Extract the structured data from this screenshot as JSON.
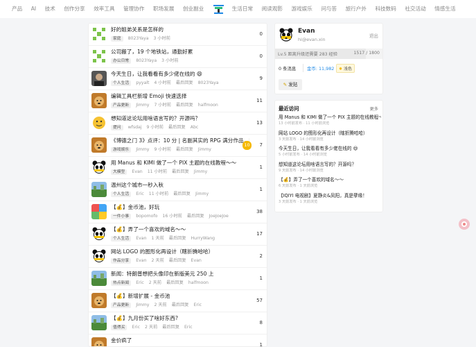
{
  "nav": [
    "产品",
    "AI",
    "技术",
    "创作分享",
    "效率工具",
    "管理协作",
    "职场发展",
    "创业副业",
    "生活日常",
    "阅读观影",
    "游戏娱乐",
    "问与答",
    "旅行户外",
    "科技数码",
    "社交活动",
    "情感生活"
  ],
  "posts": [
    {
      "title": "好的姐弟关系是怎样的",
      "tag": "家庭",
      "author": "8023Yaya",
      "time": "3 小时前",
      "last_label": "",
      "last_user": "",
      "count": "0",
      "avatar": "pixel"
    },
    {
      "title": "公司搬了，19 个地铁站，通勤好累",
      "tag": "办公日常",
      "author": "8023Yaya",
      "time": "3 小时前",
      "last_label": "",
      "last_user": "",
      "count": "0",
      "avatar": "pixel"
    },
    {
      "title": "今天生日，让我看看有多少佬在线的 😄",
      "tag": "个人生活",
      "author": "pyyalt",
      "time": "4 小时前",
      "last_label": "最后回复",
      "last_user": "8023Yaya",
      "count": "9",
      "avatar": "person"
    },
    {
      "title": "编辑工具栏新增 Emoji 快速选择",
      "tag": "产品更新",
      "author": "Jimmy",
      "time": "7 小时前",
      "last_label": "最后回复",
      "last_user": "halfmoon",
      "count": "11",
      "avatar": "doge"
    },
    {
      "title": "想知道这论坛用啥语言写的？开源吗？",
      "tag": "提问",
      "author": "wfsdaj",
      "time": "9 小时前",
      "last_label": "最后回复",
      "last_user": "Abc",
      "count": "13",
      "avatar": "emoji"
    },
    {
      "title": "《博德之门 3》点评：10 分 | 名副其实的 RPG 满分作品，即便我还没通关，也已经迫不及待的拾满分",
      "tag": "游戏娱乐",
      "author": "Jimmy",
      "time": "9 小时前",
      "last_label": "最后回复",
      "last_user": "Jimmy",
      "count": "7",
      "hot": "10",
      "avatar": "doge"
    },
    {
      "title": "用 Manus 和 KIMI 做了一个 PIX 主题的在线教程～～",
      "tag": "大模型",
      "author": "Evan",
      "time": "11 小时前",
      "last_label": "最后回复",
      "last_user": "Jimmy",
      "count": "1",
      "avatar": "panda"
    },
    {
      "title": "温州这个城市一秒入秋",
      "tag": "个人生活",
      "author": "Eric",
      "time": "11 小时前",
      "last_label": "最后回复",
      "last_user": "Jimmy",
      "count": "1",
      "avatar": "landscape"
    },
    {
      "title": "【💰】金币池，好玩",
      "tag": "一件小事",
      "author": "bopomofo",
      "time": "16 小时前",
      "last_label": "最后回复",
      "last_user": "JoeJoeJoe",
      "count": "38",
      "avatar": "colorful"
    },
    {
      "title": "【💰】弄了一个喜欢的域名～～",
      "tag": "个人生活",
      "author": "Evan",
      "time": "1 天前",
      "last_label": "最后回复",
      "last_user": "HurryWang",
      "count": "17",
      "avatar": "panda"
    },
    {
      "title": "网站 LOGO 的图形化再设计（瞎折腾哈哈）",
      "tag": "作品分享",
      "author": "Evan",
      "time": "2 天前",
      "last_label": "最后回复",
      "last_user": "Evan",
      "count": "2",
      "avatar": "panda"
    },
    {
      "title": "新闻：特朗普想把头像印在新版美元 250 上",
      "tag": "热点新闻",
      "author": "Eric",
      "time": "2 天前",
      "last_label": "最后回复",
      "last_user": "halfmoon",
      "count": "1",
      "avatar": "landscape"
    },
    {
      "title": "【💰】新增扩展 - 金币池",
      "tag": "产品更新",
      "author": "Jimmy",
      "time": "2 天前",
      "last_label": "最后回复",
      "last_user": "Eric",
      "count": "57",
      "avatar": "doge"
    },
    {
      "title": "【💰】九月份买了啥好东西?",
      "tag": "值得买",
      "author": "Eric",
      "time": "2 天前",
      "last_label": "最后回复",
      "last_user": "Eric",
      "count": "8",
      "avatar": "landscape"
    },
    {
      "title": "金价疯了",
      "tag": "",
      "author": "",
      "time": "",
      "last_label": "",
      "last_user": "",
      "count": "1",
      "avatar": "doge"
    }
  ],
  "profile": {
    "name": "Evan",
    "email": "hi@evan.xin",
    "logout": "退出",
    "level": "Lv.5 距离升级还需要 283 经验",
    "progress": "1517 / 1800",
    "progress_value": 0.843,
    "messages": "0 条消息",
    "coins_label": "金币:",
    "coins": "11,982",
    "badge": "浅色",
    "post_button": "发贴"
  },
  "recent": {
    "title": "最近访问",
    "more": "更多",
    "items": [
      {
        "title": "用 Manus 和 KIMI 做了一个 PIX 主题的在线教程～～",
        "meta": "13 小时前发布 · 11 小时前浏览"
      },
      {
        "title": "网站 LOGO 的图形化再设计（瞎折腾哈哈）",
        "meta": "3 天前发布 · 14 小时前浏览"
      },
      {
        "title": "今天生日，让我看看有多少佬在线的 😄",
        "meta": "5 小时前发布 · 14 小时前浏览"
      },
      {
        "title": "想知道这论坛用啥语言写的？开源吗？",
        "meta": "9 天前发布 · 14 小时前浏览"
      },
      {
        "title": "【💰】弄了一个喜欢的域名～～",
        "meta": "6 天前发布 · 1 天前浏览"
      },
      {
        "title": "【IQIYI 电视剧】夏静炎&凤阳，真是孽缘！",
        "meta": "3 天前发布 · 1 天前浏览"
      }
    ]
  },
  "colors": {
    "accent": "#1e88e5",
    "hot": "#f5b800"
  }
}
